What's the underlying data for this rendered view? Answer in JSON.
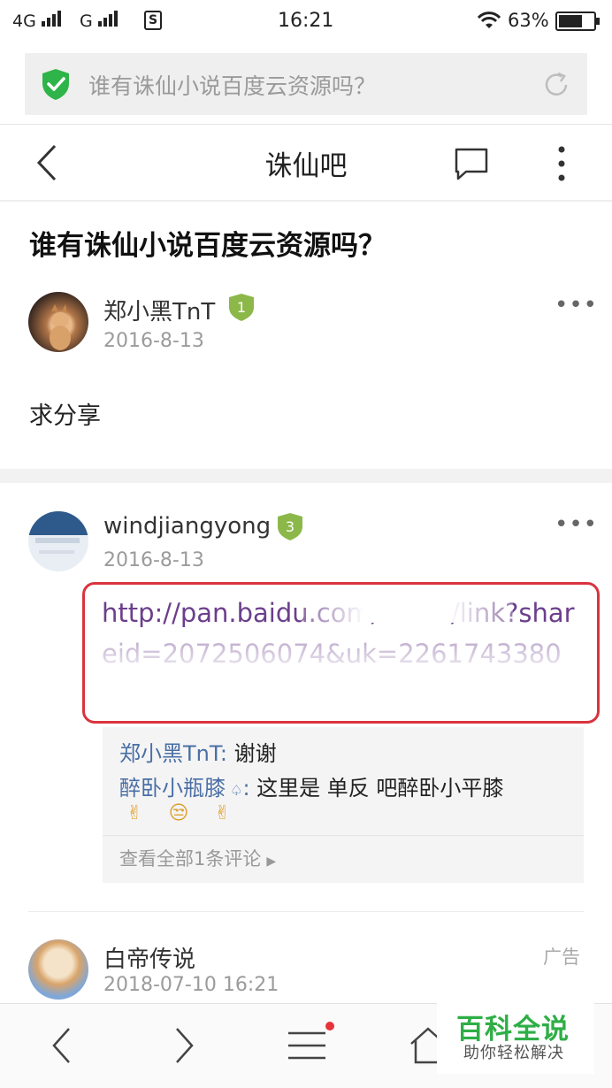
{
  "status_bar": {
    "network1": "4G",
    "network2": "G",
    "sim_icon": "S",
    "time": "16:21",
    "battery": "63%"
  },
  "url_bar": {
    "text": "谁有诛仙小说百度云资源吗？"
  },
  "header": {
    "title": "诛仙吧"
  },
  "post": {
    "title": "谁有诛仙小说百度云资源吗？",
    "author": "郑小黑TnT",
    "level": "1",
    "date": "2016-8-13",
    "content": "求分享"
  },
  "reply": {
    "author": "windjiangyong",
    "level": "3",
    "date": "2016-8-13",
    "link_text": "http://pan.baidu.com/share/link?shareid=2072506074&uk=2261743380",
    "comments": [
      {
        "user": "郑小黑TnT",
        "sep": ":",
        "text": " 谢谢"
      },
      {
        "user": "醉卧小瓶膝",
        "sep": ":",
        "text": " 这里是 单反 吧醉卧小平膝"
      }
    ],
    "emojis": [
      "✌",
      "😒",
      "✌"
    ],
    "view_all": "查看全部1条评论"
  },
  "ad": {
    "author": "白帝传说",
    "date": "2018-07-10 16:21",
    "tag": "广告"
  },
  "watermark": {
    "title": "百科全说",
    "subtitle": "助你轻松解决"
  },
  "colors": {
    "level_badge": "#8cb84a",
    "shield": "#2fb44a",
    "link": "#6b3f8c",
    "highlight_box": "#d9343e",
    "comment_user": "#4a6fa5"
  }
}
